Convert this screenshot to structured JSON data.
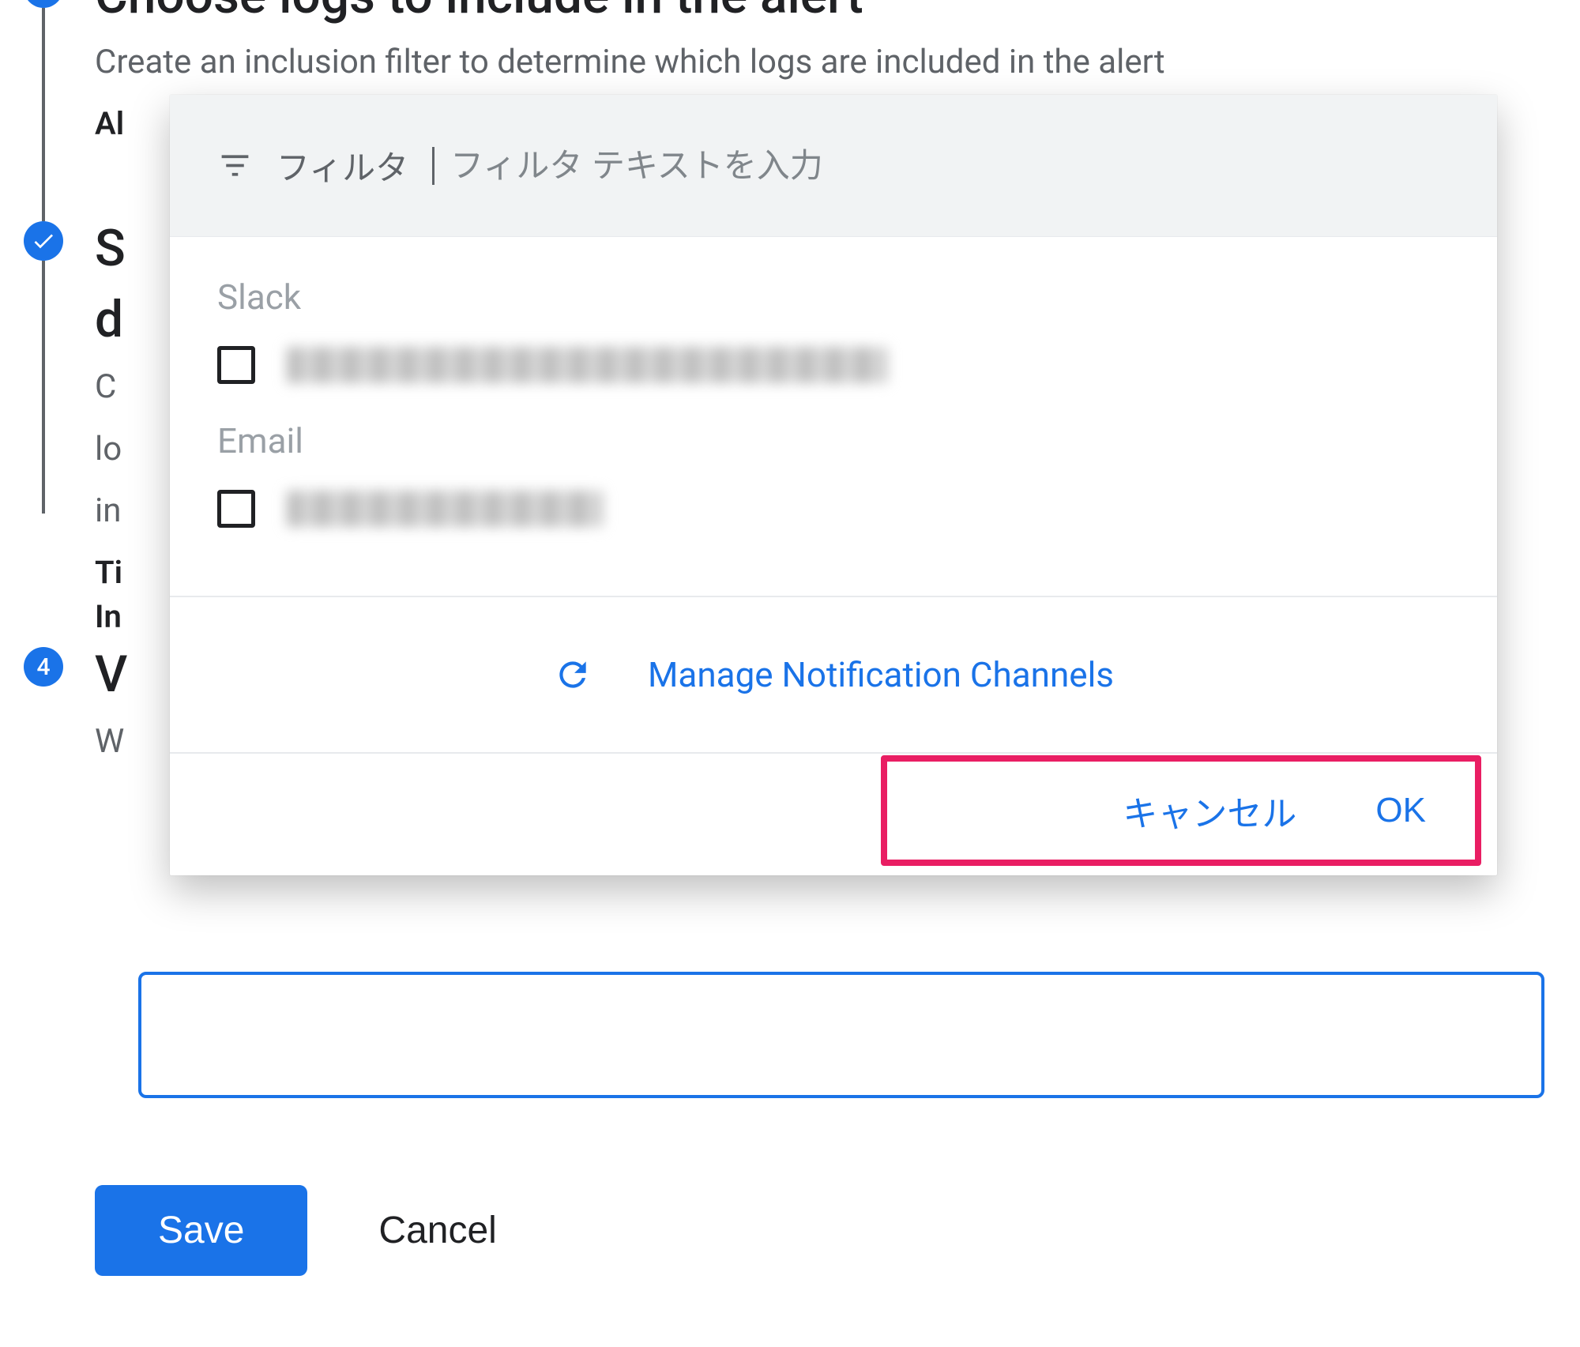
{
  "steps": {
    "s1": {
      "title": "Choose logs to include in the alert",
      "desc": "Create an inclusion filter to determine which logs are included in the alert",
      "label1": "Al"
    },
    "s2": {
      "title_line1": "S",
      "title_line2": "d",
      "desc_c": "C",
      "desc_lo": "lo",
      "desc_in": "in",
      "label_ti": "Ti",
      "label_in": "In"
    },
    "s3": {
      "number": "4",
      "title": "V",
      "desc": "W"
    }
  },
  "modal": {
    "filter_label": "フィルタ",
    "filter_placeholder": "フィルタ テキストを入力",
    "sections": {
      "slack": "Slack",
      "email": "Email"
    },
    "manage_link": "Manage Notification Channels",
    "cancel": "キャンセル",
    "ok": "OK"
  },
  "bottom": {
    "save": "Save",
    "cancel": "Cancel"
  }
}
